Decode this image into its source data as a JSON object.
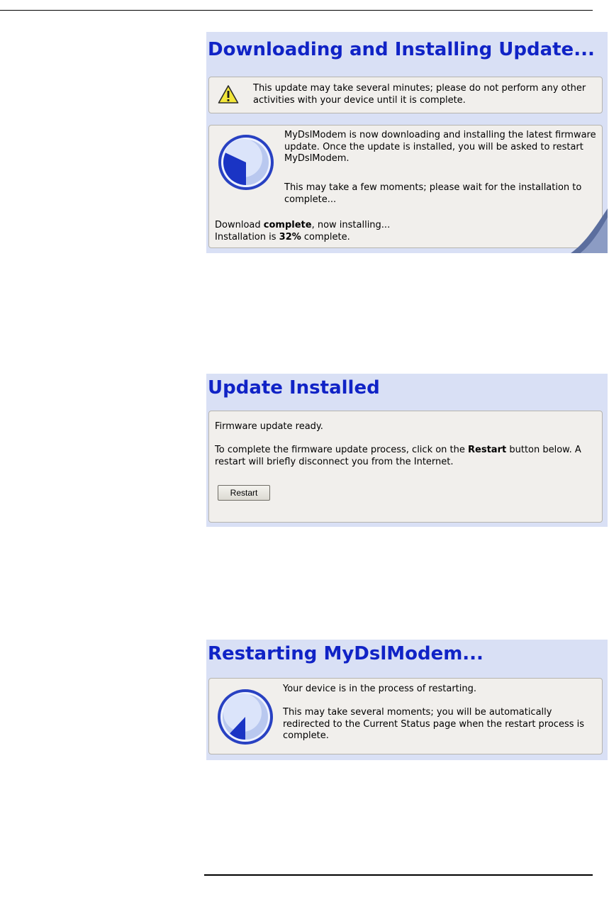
{
  "panel1": {
    "title": "Downloading and Installing Update...",
    "warning_text": "This update may take several minutes; please do not perform any other activities with your device until it is complete.",
    "info_text": "MyDslModem is now downloading and installing the latest firmware update. Once the update is installed, you will be asked to restart MyDslModem.",
    "wait_text": "This may take a few moments; please wait for the installation to complete...",
    "download_prefix": "Download ",
    "download_status": "complete",
    "download_suffix": ", now installing...",
    "install_prefix": "Installation is ",
    "install_percent": "32%",
    "install_suffix": " complete.",
    "progress_fraction": 0.32
  },
  "panel2": {
    "title": "Update Installed",
    "ready_text": "Firmware update ready.",
    "instruction_prefix": "To complete the firmware update process, click on the ",
    "instruction_bold": "Restart",
    "instruction_suffix": " button below. A restart will briefly disconnect you from the Internet.",
    "restart_button": "Restart"
  },
  "panel3": {
    "title": "Restarting MyDslModem...",
    "status_text": "Your device is in the process of restarting.",
    "detail_text": "This may take several moments; you will be automatically redirected to the Current Status page when the restart process is complete.",
    "progress_fraction": 0.12
  },
  "icons": {
    "warning": "warning-triangle-icon",
    "progress": "progress-clock-icon"
  },
  "colors": {
    "title_blue": "#1023c6",
    "panel_background": "#d9e0f5",
    "box_background": "#f1efec",
    "progress_blue": "#1a34c4",
    "warning_yellow": "#f2e63a"
  }
}
